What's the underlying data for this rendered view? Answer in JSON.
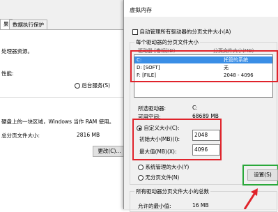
{
  "bg": {
    "tab_partial": "果",
    "tab_dep": "数据执行保护",
    "line1": "处理器资源。",
    "line2": "性能:",
    "radio_background": "后台服务(S)",
    "line3": "硬盘上的一块区域，Windows 当作 RAM 使用。",
    "line4": "总分页文件大小:",
    "total_value": "2816 MB",
    "change_button": "更改(C)..."
  },
  "vm": {
    "title": "虚拟内存",
    "auto_manage": "自动管理所有驱动器的分页文件大小(A)",
    "group_label": "每个驱动器的分页文件大小",
    "col_drive": "驱动器 [卷标](D)",
    "col_size": "分页文件大小(MB)",
    "drives": [
      {
        "drive": "C:",
        "size": "托管的系统"
      },
      {
        "drive": "D:       [SOFT]",
        "size": "无"
      },
      {
        "drive": "F:       [FILE]",
        "size": "2048 - 4096"
      }
    ],
    "selected_drive_label": "所选驱动器:",
    "selected_drive_value": "C:",
    "free_space_label": "可用空间:",
    "free_space_value": "68689 MB",
    "custom_size": "自定义大小(C):",
    "initial_label": "初始大小(MB)(I):",
    "initial_value": "2048",
    "max_label": "最大值(MB)(X):",
    "max_value": "4096",
    "system_managed": "系统管理的大小(Y)",
    "no_paging": "无分页文件(N)",
    "set_button": "设置(S)",
    "total_group": "所有驱动器分页文件大小的总数",
    "min_allowed_label": "允许的最小值:",
    "min_allowed_value": "16 MB"
  },
  "colors": {
    "highlight_red": "#e0232b",
    "highlight_green": "#2aa83a",
    "selection": "#3a8ee6"
  }
}
